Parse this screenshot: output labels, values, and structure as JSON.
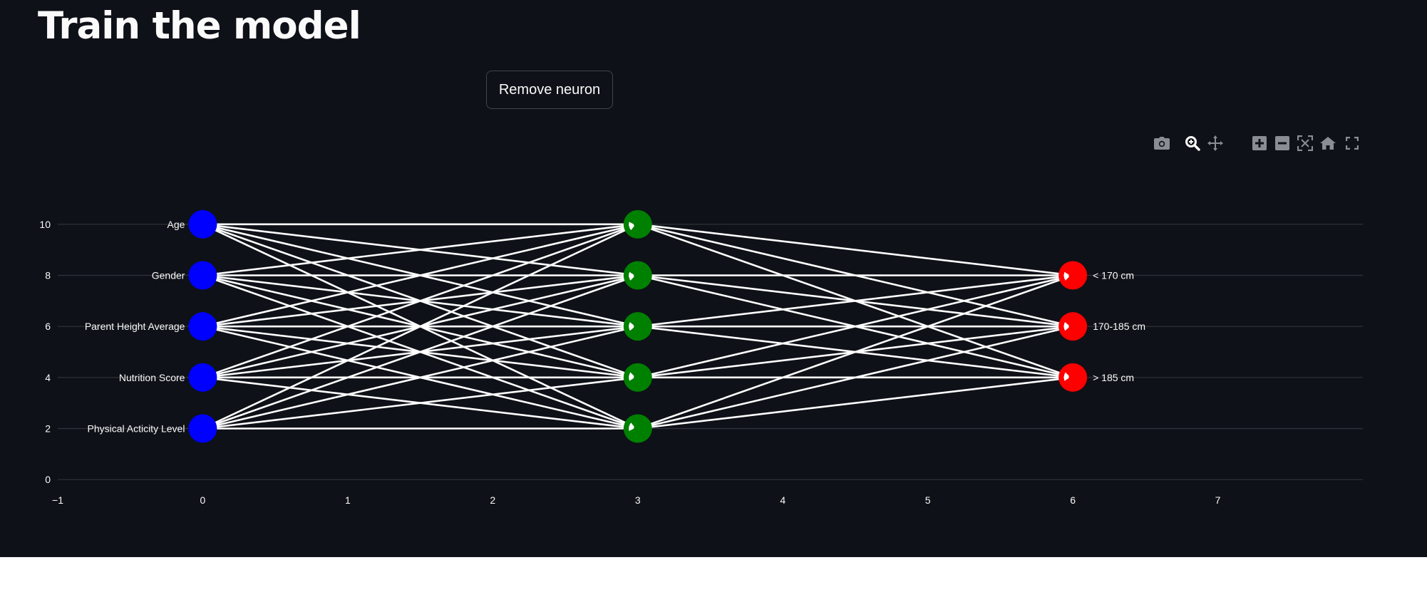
{
  "page": {
    "title": "Train the model"
  },
  "controls": {
    "remove_neuron_label": "Remove neuron"
  },
  "modebar": [
    {
      "name": "camera-icon",
      "title": "Download plot as a png"
    },
    {
      "name": "zoom-icon",
      "title": "Zoom"
    },
    {
      "name": "pan-icon",
      "title": "Pan"
    },
    {
      "name": "zoom-in-icon",
      "title": "Zoom in"
    },
    {
      "name": "zoom-out-icon",
      "title": "Zoom out"
    },
    {
      "name": "autoscale-icon",
      "title": "Autoscale"
    },
    {
      "name": "reset-axes-icon",
      "title": "Reset axes"
    },
    {
      "name": "fullscreen-icon",
      "title": "Fullscreen"
    }
  ],
  "colors": {
    "background": "#0e1117",
    "text": "#fafafa",
    "input_layer": "#0000ff",
    "hidden_layer": "#008000",
    "output_layer": "#ff0000",
    "edges": "#ffffff",
    "grid": "#31343d",
    "modebar_icon": "#8a8d93"
  },
  "chart_data": {
    "type": "scatter",
    "title": "",
    "xlabel": "",
    "ylabel": "",
    "xlim": [
      -1,
      8
    ],
    "ylim": [
      -1,
      11
    ],
    "x_ticks": [
      -1,
      0,
      1,
      2,
      3,
      4,
      5,
      6,
      7
    ],
    "y_ticks": [
      0,
      2,
      4,
      6,
      8,
      10
    ],
    "grid": "horizontal",
    "nodes": [
      {
        "layer": "input",
        "x": 0,
        "y": 10,
        "label": "Age"
      },
      {
        "layer": "input",
        "x": 0,
        "y": 8,
        "label": "Gender"
      },
      {
        "layer": "input",
        "x": 0,
        "y": 6,
        "label": "Parent Height Average"
      },
      {
        "layer": "input",
        "x": 0,
        "y": 4,
        "label": "Nutrition Score"
      },
      {
        "layer": "input",
        "x": 0,
        "y": 2,
        "label": "Physical Acticity Level"
      },
      {
        "layer": "hidden",
        "x": 3,
        "y": 10,
        "label": ""
      },
      {
        "layer": "hidden",
        "x": 3,
        "y": 8,
        "label": ""
      },
      {
        "layer": "hidden",
        "x": 3,
        "y": 6,
        "label": ""
      },
      {
        "layer": "hidden",
        "x": 3,
        "y": 4,
        "label": ""
      },
      {
        "layer": "hidden",
        "x": 3,
        "y": 2,
        "label": ""
      },
      {
        "layer": "output",
        "x": 6,
        "y": 8,
        "label": "< 170 cm"
      },
      {
        "layer": "output",
        "x": 6,
        "y": 6,
        "label": "170-185 cm"
      },
      {
        "layer": "output",
        "x": 6,
        "y": 4,
        "label": "> 185 cm"
      }
    ],
    "edges": [
      {
        "from": "input",
        "to": "hidden"
      },
      {
        "from": "hidden",
        "to": "output"
      }
    ]
  }
}
